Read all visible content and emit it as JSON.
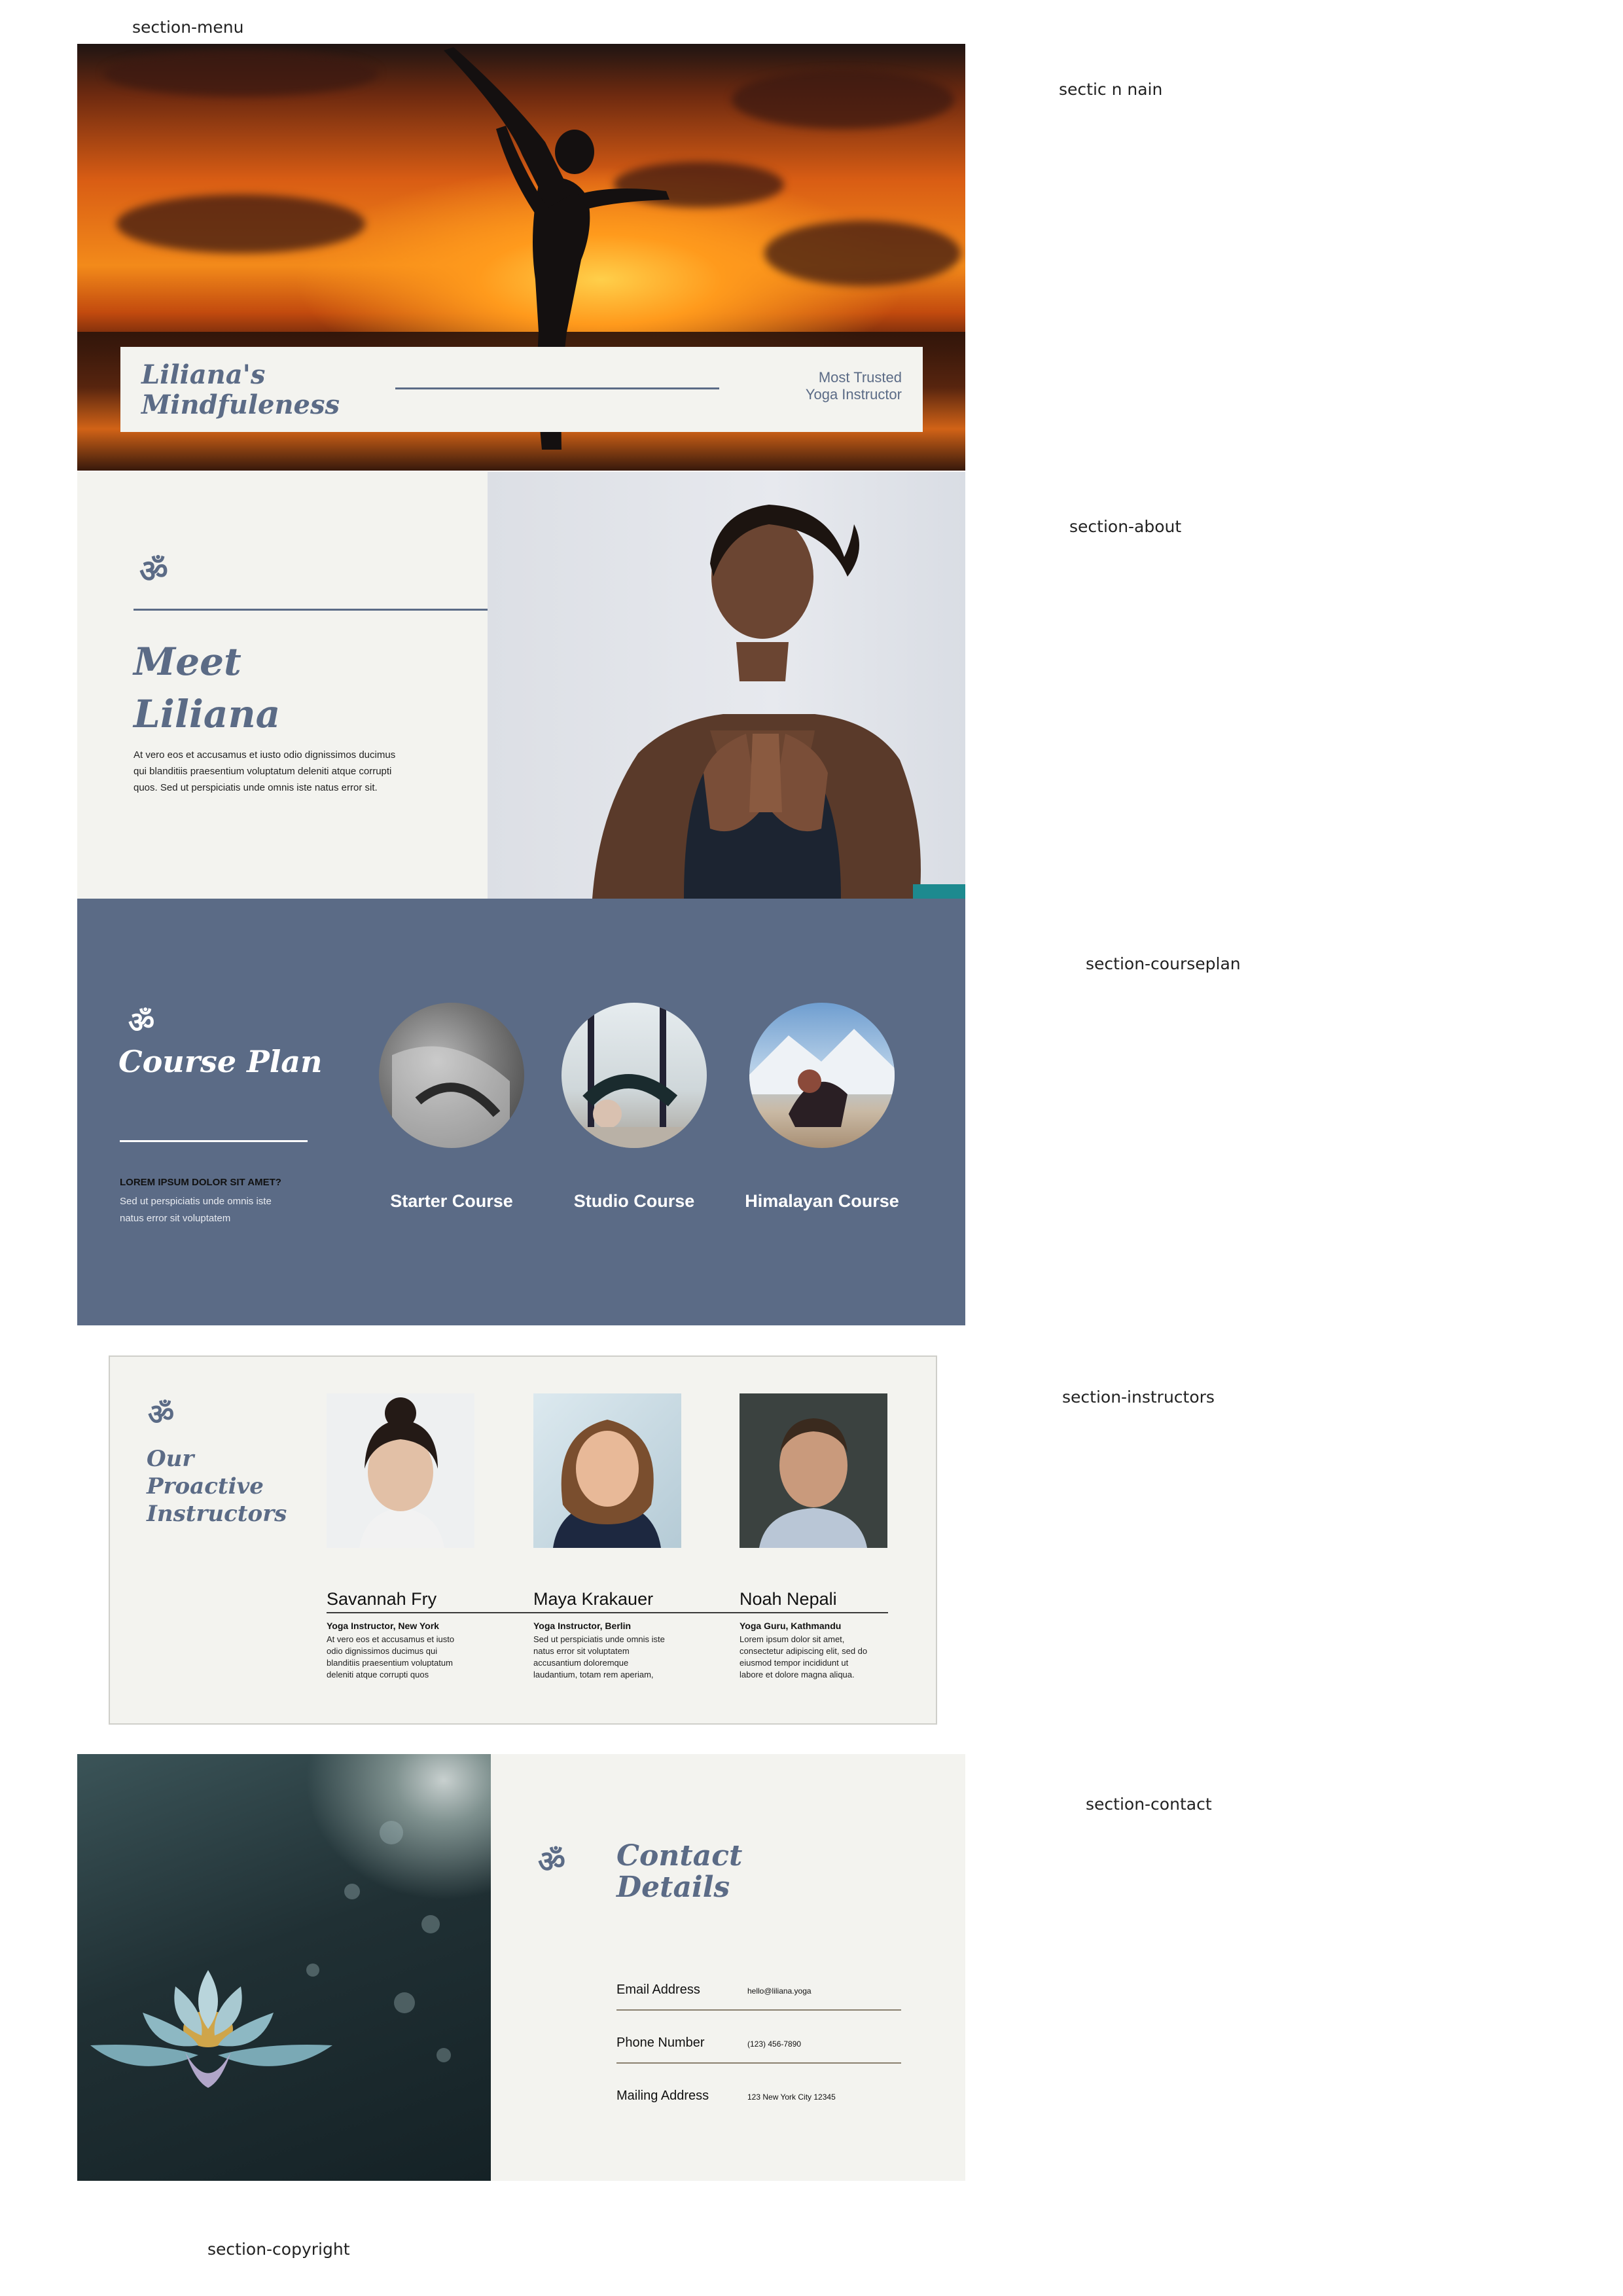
{
  "labels": {
    "menu": "section-menu",
    "main": "sectic n nain",
    "about": "section-about",
    "courseplan": "section-courseplan",
    "instructors": "section-instructors",
    "contact": "section-contact",
    "copyright": "section-copyright"
  },
  "hero": {
    "brand_line1": "Liliana's",
    "brand_line2": "Mindfuleness",
    "tagline_line1": "Most Trusted",
    "tagline_line2": "Yoga Instructor"
  },
  "about": {
    "om_symbol": "ॐ",
    "title_line1": "Meet",
    "title_line2": "Liliana",
    "body_line1": "At vero eos et accusamus et iusto odio dignissimos ducimus",
    "body_line2": "qui blanditiis praesentium voluptatum deleniti atque corrupti",
    "body_line3": "quos. Sed ut perspiciatis unde omnis iste natus error sit."
  },
  "course_plan": {
    "om_symbol": "ॐ",
    "title": "Course Plan",
    "subhead": "LOREM IPSUM DOLOR SIT AMET?",
    "body_line1": "Sed ut perspiciatis unde omnis iste",
    "body_line2": "natus error sit voluptatem",
    "courses": [
      {
        "name": "Starter Course"
      },
      {
        "name": "Studio Course"
      },
      {
        "name": "Himalayan Course"
      }
    ]
  },
  "instructors": {
    "om_symbol": "ॐ",
    "title_line1": "Our",
    "title_line2": "Proactive",
    "title_line3": "Instructors",
    "people": [
      {
        "name": "Savannah Fry",
        "role": "Yoga Instructor, New York",
        "bio1": "At vero eos et accusamus et iusto",
        "bio2": "odio dignissimos ducimus qui",
        "bio3": "blanditiis praesentium voluptatum",
        "bio4": "deleniti atque corrupti quos"
      },
      {
        "name": "Maya Krakauer",
        "role": "Yoga Instructor, Berlin",
        "bio1": "Sed ut perspiciatis unde omnis iste",
        "bio2": "natus error sit voluptatem",
        "bio3": "accusantium doloremque",
        "bio4": "laudantium, totam rem aperiam,"
      },
      {
        "name": "Noah Nepali",
        "role": "Yoga Guru, Kathmandu",
        "bio1": "Lorem ipsum dolor sit amet,",
        "bio2": "consectetur adipiscing elit, sed do",
        "bio3": "eiusmod tempor incididunt ut",
        "bio4": "labore et dolore magna aliqua."
      }
    ]
  },
  "contact": {
    "om_symbol": "ॐ",
    "title_line1": "Contact",
    "title_line2": "Details",
    "email_label": "Email Address",
    "email_value": "hello@liliana.yoga",
    "phone_label": "Phone Number",
    "phone_value": "(123) 456-7890",
    "address_label": "Mailing Address",
    "address_value": "123 New York City 12345"
  },
  "colors": {
    "accent": "#5b6b86",
    "panel": "#f3f3ef",
    "divider": "#8a8070"
  }
}
